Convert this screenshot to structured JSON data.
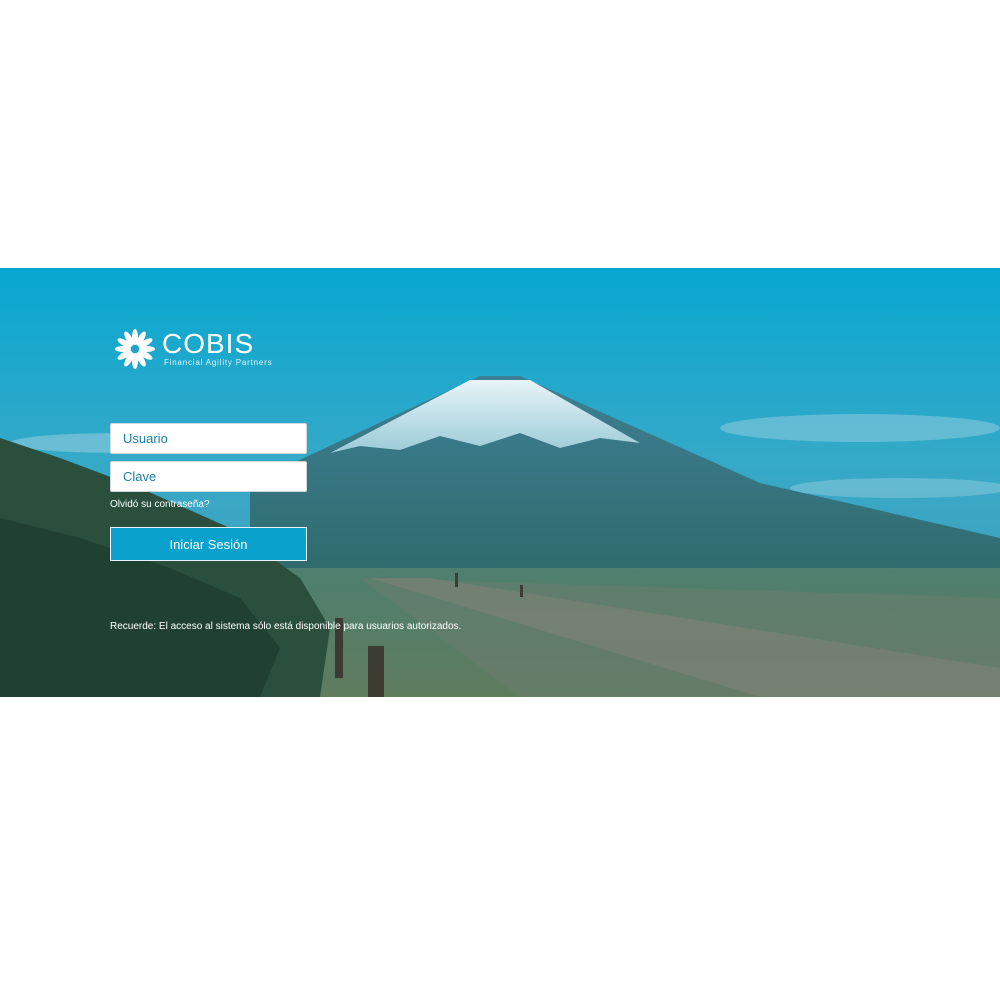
{
  "brand": {
    "name": "COBIS",
    "tagline": "Financial Agility Partners"
  },
  "login": {
    "username_placeholder": "Usuario",
    "password_placeholder": "Clave",
    "forgot_label": "Olvidó su contraseña?",
    "submit_label": "Iniciar Sesión"
  },
  "notice": "Recuerde: El acceso al sistema sólo está disponible para usuarios autorizados.",
  "colors": {
    "accent": "#0aa2cc",
    "field_text": "#1b7fa8"
  },
  "icons": {
    "logo": "cobis-flower-logo"
  }
}
